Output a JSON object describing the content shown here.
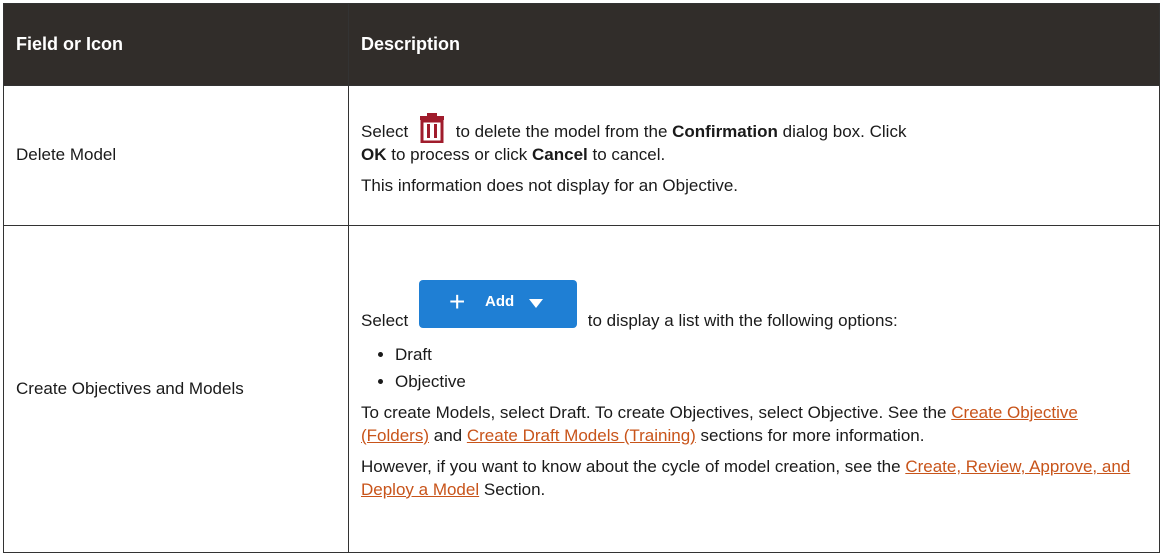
{
  "table": {
    "headers": {
      "col1": "Field or Icon",
      "col2": "Description"
    },
    "row1": {
      "field": "Delete Model",
      "select": "Select",
      "icon": "trash-icon",
      "text1": "to delete the model from the",
      "confirmation": "Confirmation",
      "text2": "dialog box. Click",
      "ok": "OK",
      "text3": "to process or click",
      "cancel": "Cancel",
      "text4": "to cancel.",
      "note": "This information does not display for an Objective."
    },
    "row2": {
      "field": "Create Objectives and Models",
      "select": "Select",
      "add_button_label": "Add",
      "text1": "to display a list with the following options:",
      "options": [
        "Draft",
        "Objective"
      ],
      "para1_a": "To create Models, select Draft. To create Objectives, select Objective. See the",
      "link1": "Create Objective (Folders)",
      "and": "and",
      "link2": "Create Draft Models (Training)",
      "para1_b": "sections for more information.",
      "para2_a": "However, if you want to know about the cycle of model creation, see the",
      "link3": "Create, Review, Approve, and Deploy a Model",
      "para2_b": "Section."
    }
  },
  "colors": {
    "header_bg": "#312d2a",
    "link": "#c8541a",
    "button": "#1f7fd4",
    "trash_icon": "#a01c2c"
  }
}
